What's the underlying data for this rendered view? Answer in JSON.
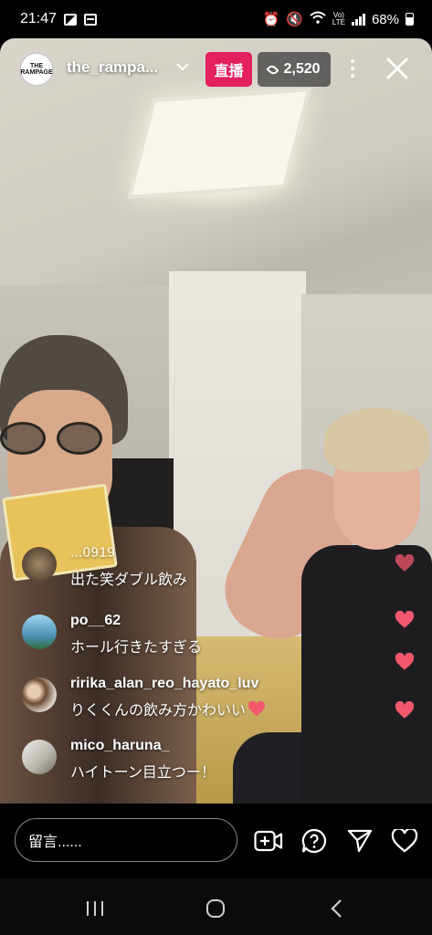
{
  "status_bar": {
    "time": "21:47",
    "battery": "68%"
  },
  "header": {
    "avatar_text": "THE RAMPAGE",
    "username": "the_rampa...",
    "live_label": "直播",
    "viewer_count": "2,520"
  },
  "comments": [
    {
      "user": "...0919",
      "message": "出た笑ダブル飲み"
    },
    {
      "user": "po__62",
      "message": "ホール行きたすぎる"
    },
    {
      "user": "ririka_alan_reo_hayato_luv",
      "message": "りくくんの飲み方かわいい"
    },
    {
      "user": "mico_haruna_",
      "message": "ハイトーン目立つー！"
    }
  ],
  "bottom_bar": {
    "comment_placeholder": "留言......"
  },
  "colors": {
    "live_badge": "#e4205f",
    "heart": "#f2576d"
  }
}
